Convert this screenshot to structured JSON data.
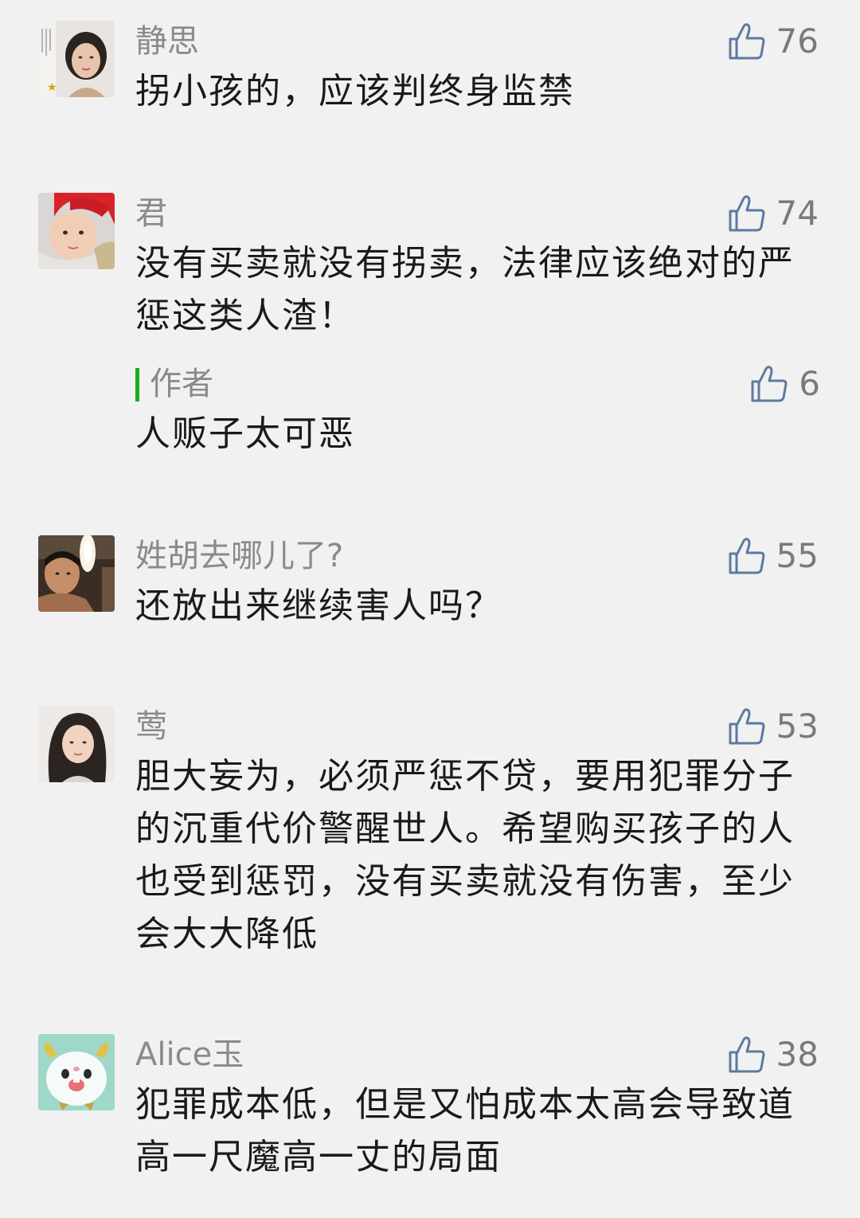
{
  "comments": [
    {
      "nickname": "静思",
      "likes": "76",
      "text": "拐小孩的，应该判终身监禁",
      "avatar_icon": "avatar-woman-photo"
    },
    {
      "nickname": "君",
      "likes": "74",
      "text": "没有买卖就没有拐卖，法律应该绝对的严惩这类人渣！",
      "avatar_icon": "avatar-baby-photo",
      "reply": {
        "author_label": "作者",
        "likes": "6",
        "text": "人贩子太可恶"
      }
    },
    {
      "nickname": "姓胡去哪儿了?",
      "likes": "55",
      "text": "还放出来继续害人吗？",
      "avatar_icon": "avatar-man-photo"
    },
    {
      "nickname": "莺",
      "likes": "53",
      "text": "胆大妄为，必须严惩不贷，要用犯罪分子的沉重代价警醒世人。希望购买孩子的人也受到惩罚，没有买卖就没有伤害，至少会大大降低",
      "avatar_icon": "avatar-girl-photo"
    },
    {
      "nickname": "Alice玉",
      "likes": "38",
      "text": "犯罪成本低，但是又怕成本太高会导致道高一尺魔高一丈的局面",
      "avatar_icon": "avatar-cartoon-poro"
    }
  ],
  "colors": {
    "background": "#f1f1f1",
    "author_bar": "#1aad19",
    "nickname": "#8a8a8a",
    "text": "#1a1a1a"
  }
}
